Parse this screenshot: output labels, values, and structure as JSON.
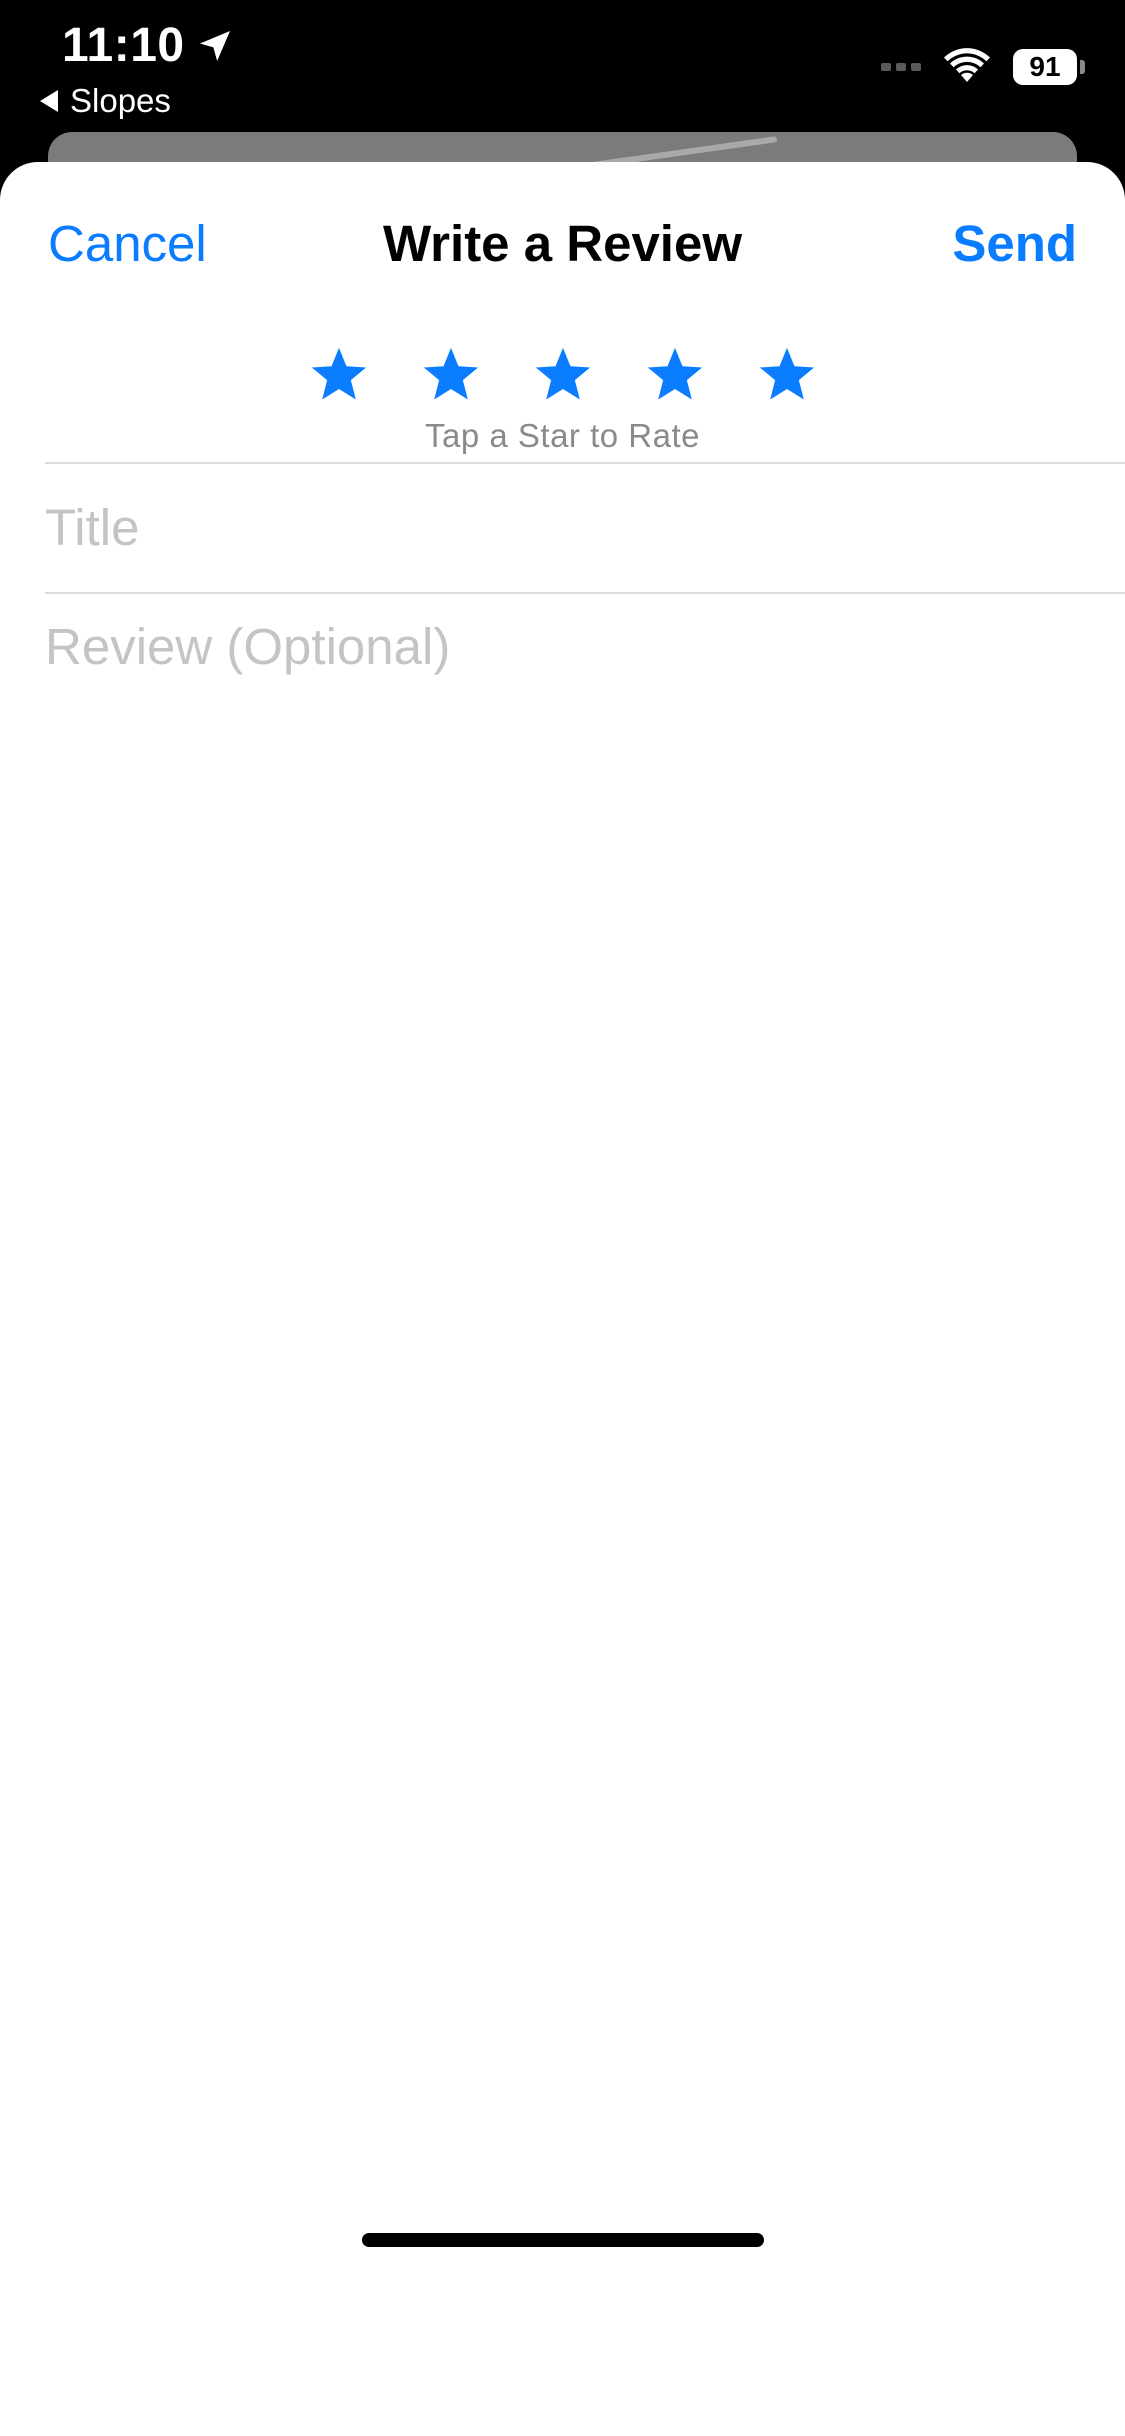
{
  "status_bar": {
    "time": "11:10",
    "location_icon": "location-arrow-icon",
    "back_label": "Slopes",
    "battery": "91",
    "wifi_icon": "wifi-icon"
  },
  "nav": {
    "cancel_label": "Cancel",
    "title": "Write a Review",
    "send_label": "Send"
  },
  "rating": {
    "stars": 5,
    "star_color": "#0a7cff",
    "hint": "Tap a Star to Rate"
  },
  "form": {
    "title_placeholder": "Title",
    "title_value": "",
    "review_placeholder": "Review (Optional)",
    "review_value": ""
  },
  "colors": {
    "accent": "#0a7cff",
    "placeholder": "#c4c4c7",
    "secondary_text": "#8a8a8e"
  }
}
